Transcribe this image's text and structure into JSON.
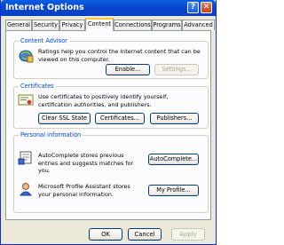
{
  "window": {
    "title": "Internet Options",
    "help_glyph": "?",
    "close_glyph": "✕"
  },
  "tabs": [
    "General",
    "Security",
    "Privacy",
    "Content",
    "Connections",
    "Programs",
    "Advanced"
  ],
  "active_tab": "Content",
  "content_advisor": {
    "label": "Content Advisor",
    "text": "Ratings help you control the Internet content that can be viewed on this computer.",
    "enable": "Enable...",
    "settings": "Settings..."
  },
  "certificates": {
    "label": "Certificates",
    "text": "Use certificates to positively identify yourself, certification authorities, and publishers.",
    "clear_ssl": "Clear SSL State",
    "certificates": "Certificates...",
    "publishers": "Publishers..."
  },
  "personal": {
    "label": "Personal information",
    "autocomplete_text": "AutoComplete stores previous entries and suggests matches for you.",
    "autocomplete": "AutoComplete...",
    "profile_text": "Microsoft Profile Assistant stores your personal information.",
    "profile": "My Profile..."
  },
  "footer": {
    "ok": "OK",
    "cancel": "Cancel",
    "apply": "Apply"
  }
}
